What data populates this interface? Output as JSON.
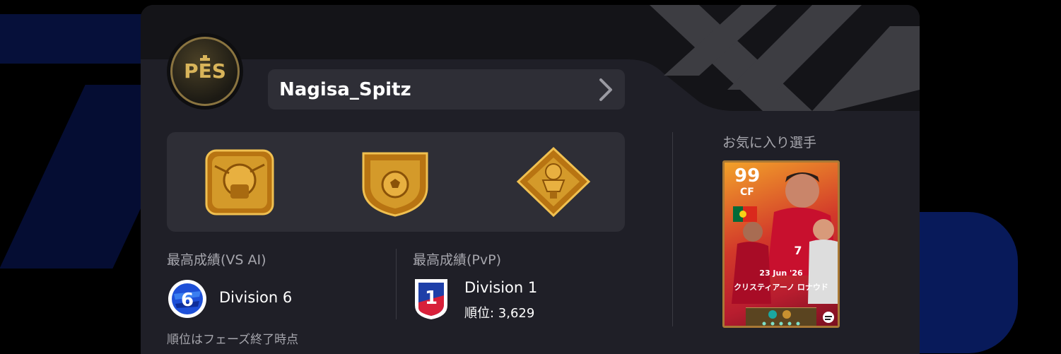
{
  "profile": {
    "username": "Nagisa_Spitz",
    "emblem_icon": "pes-logo-icon",
    "arrow_icon": "chevron-right-icon"
  },
  "badges": [
    {
      "name": "fist-badge-icon"
    },
    {
      "name": "football-shield-badge-icon"
    },
    {
      "name": "trophy-diamond-badge-icon"
    }
  ],
  "vs_ai": {
    "title": "最高成績(VS AI)",
    "division_number": "6",
    "division_label": "Division 6"
  },
  "pvp": {
    "title": "最高成績(PvP)",
    "division_number": "1",
    "division_label": "Division 1",
    "rank_label": "順位: 3,629"
  },
  "note": "順位はフェーズ終了時点",
  "favorite": {
    "title": "お気に入り選手",
    "rating": "99",
    "position": "CF",
    "date": "23 Jun '26",
    "player_name": "クリスティアーノ ロナウド"
  },
  "colors": {
    "panel": "#1f1f27",
    "box": "#2e2e36",
    "gold": "#d49a2a",
    "division_blue": "#1e50d8"
  }
}
